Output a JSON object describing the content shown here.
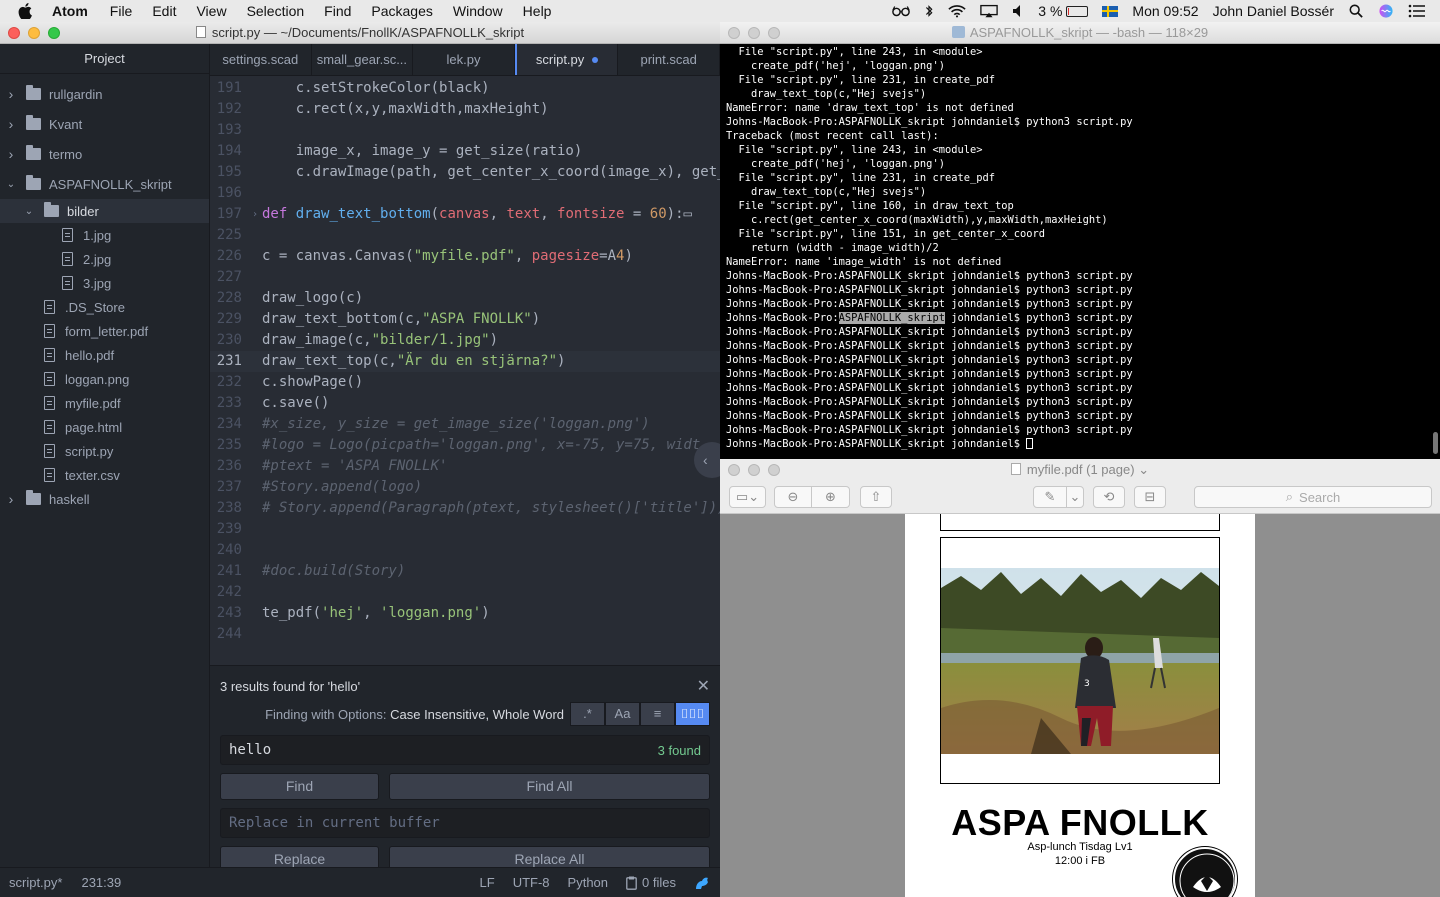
{
  "menubar": {
    "app": "Atom",
    "items": [
      "File",
      "Edit",
      "View",
      "Selection",
      "Find",
      "Packages",
      "Window",
      "Help"
    ],
    "battery": "3 %",
    "clock": "Mon 09:52",
    "user": "John Daniel Bossér"
  },
  "atom": {
    "title": "script.py — ~/Documents/FnollK/ASPAFNOLLK_skript",
    "tree_header": "Project",
    "tree": [
      {
        "label": "rullgardin",
        "kind": "folder",
        "expanded": false,
        "depth": 0
      },
      {
        "label": "Kvant",
        "kind": "folder",
        "expanded": false,
        "depth": 0
      },
      {
        "label": "termo",
        "kind": "folder",
        "expanded": false,
        "depth": 0
      },
      {
        "label": "ASPAFNOLLK_skript",
        "kind": "folder",
        "expanded": true,
        "depth": 0
      },
      {
        "label": "bilder",
        "kind": "folder",
        "expanded": true,
        "depth": 1,
        "selected": true
      },
      {
        "label": "1.jpg",
        "kind": "image",
        "depth": 2
      },
      {
        "label": "2.jpg",
        "kind": "image",
        "depth": 2
      },
      {
        "label": "3.jpg",
        "kind": "image",
        "depth": 2
      },
      {
        "label": ".DS_Store",
        "kind": "file",
        "depth": 1
      },
      {
        "label": "form_letter.pdf",
        "kind": "pdf",
        "depth": 1
      },
      {
        "label": "hello.pdf",
        "kind": "pdf",
        "depth": 1
      },
      {
        "label": "loggan.png",
        "kind": "image",
        "depth": 1
      },
      {
        "label": "myfile.pdf",
        "kind": "pdf",
        "depth": 1
      },
      {
        "label": "page.html",
        "kind": "file",
        "depth": 1
      },
      {
        "label": "script.py",
        "kind": "file",
        "depth": 1
      },
      {
        "label": "texter.csv",
        "kind": "file",
        "depth": 1
      },
      {
        "label": "haskell",
        "kind": "folder",
        "expanded": false,
        "depth": 0
      }
    ],
    "tabs": [
      {
        "label": "settings.scad",
        "active": false
      },
      {
        "label": "small_gear.sc...",
        "active": false
      },
      {
        "label": "lek.py",
        "active": false
      },
      {
        "label": "script.py",
        "active": true,
        "modified": true
      },
      {
        "label": "print.scad",
        "active": false
      }
    ],
    "code": [
      {
        "n": "191",
        "t": "    c.setStrokeColor(black)"
      },
      {
        "n": "192",
        "t": "    c.rect(x,y,maxWidth,maxHeight)"
      },
      {
        "n": "193",
        "t": ""
      },
      {
        "n": "194",
        "t": "    image_x, image_y = get_size(ratio)"
      },
      {
        "n": "195",
        "t": "    c.drawImage(path, get_center_x_coord(image_x), get_"
      },
      {
        "n": "196",
        "t": ""
      },
      {
        "n": "197",
        "t": "def draw_text_bottom(canvas, text, fontsize = 60):▭",
        "fold": true
      },
      {
        "n": "225",
        "t": ""
      },
      {
        "n": "226",
        "t": "c = canvas.Canvas(\"myfile.pdf\", pagesize=A4)"
      },
      {
        "n": "227",
        "t": ""
      },
      {
        "n": "228",
        "t": "draw_logo(c)"
      },
      {
        "n": "229",
        "t": "draw_text_bottom(c,\"ASPA FNOLLK\")"
      },
      {
        "n": "230",
        "t": "draw_image(c,\"bilder/1.jpg\")"
      },
      {
        "n": "231",
        "t": "draw_text_top(c,\"Är du en stjärna?\")",
        "current": true
      },
      {
        "n": "232",
        "t": "c.showPage()"
      },
      {
        "n": "233",
        "t": "c.save()"
      },
      {
        "n": "234",
        "t": "#x_size, y_size = get_image_size('loggan.png')"
      },
      {
        "n": "235",
        "t": "#logo = Logo(picpath='loggan.png', x=-75, y=75, widt"
      },
      {
        "n": "236",
        "t": "#ptext = 'ASPA FNOLLK'"
      },
      {
        "n": "237",
        "t": "#Story.append(logo)"
      },
      {
        "n": "238",
        "t": "# Story.append(Paragraph(ptext, stylesheet()['title']))"
      },
      {
        "n": "239",
        "t": ""
      },
      {
        "n": "240",
        "t": ""
      },
      {
        "n": "241",
        "t": "#doc.build(Story)"
      },
      {
        "n": "242",
        "t": ""
      },
      {
        "n": "243",
        "t": "te_pdf('hej', 'loggan.png')"
      },
      {
        "n": "244",
        "t": ""
      }
    ],
    "find": {
      "summary": "3 results found for 'hello'",
      "options_prefix": "Finding with Options:",
      "options": "Case Insensitive, Whole Word",
      "toggles": [
        ".*",
        "Aa",
        "≡",
        "⌷⌷⌷"
      ],
      "query": "hello",
      "count": "3 found",
      "find_label": "Find",
      "find_all_label": "Find All",
      "replace_placeholder": "Replace in current buffer",
      "replace_label": "Replace",
      "replace_all_label": "Replace All"
    },
    "status": {
      "file": "script.py*",
      "cursor": "231:39",
      "eol": "LF",
      "encoding": "UTF-8",
      "grammar": "Python",
      "files": "0 files"
    }
  },
  "terminal": {
    "title": "ASPAFNOLLK_skript — -bash — 118×29",
    "lines": [
      "  File \"script.py\", line 243, in <module>",
      "    create_pdf('hej', 'loggan.png')",
      "  File \"script.py\", line 231, in create_pdf",
      "    draw_text_top(c,\"Hej svejs\")",
      "NameError: name 'draw_text_top' is not defined",
      "Johns-MacBook-Pro:ASPAFNOLLK_skript johndaniel$ python3 script.py",
      "Traceback (most recent call last):",
      "  File \"script.py\", line 243, in <module>",
      "    create_pdf('hej', 'loggan.png')",
      "  File \"script.py\", line 231, in create_pdf",
      "    draw_text_top(c,\"Hej svejs\")",
      "  File \"script.py\", line 160, in draw_text_top",
      "    c.rect(get_center_x_coord(maxWidth),y,maxWidth,maxHeight)",
      "  File \"script.py\", line 151, in get_center_x_coord",
      "    return (width - image_width)/2",
      "NameError: name 'image_width' is not defined",
      "Johns-MacBook-Pro:ASPAFNOLLK_skript johndaniel$ python3 script.py",
      "Johns-MacBook-Pro:ASPAFNOLLK_skript johndaniel$ python3 script.py",
      "Johns-MacBook-Pro:ASPAFNOLLK_skript johndaniel$ python3 script.py",
      "Johns-MacBook-Pro:ASPAFNOLLK_skript johndaniel$ python3 script.py",
      "Johns-MacBook-Pro:ASPAFNOLLK_skript johndaniel$ python3 script.py",
      "Johns-MacBook-Pro:ASPAFNOLLK_skript johndaniel$ python3 script.py",
      "Johns-MacBook-Pro:ASPAFNOLLK_skript johndaniel$ python3 script.py",
      "Johns-MacBook-Pro:ASPAFNOLLK_skript johndaniel$ python3 script.py",
      "Johns-MacBook-Pro:ASPAFNOLLK_skript johndaniel$ python3 script.py",
      "Johns-MacBook-Pro:ASPAFNOLLK_skript johndaniel$ python3 script.py",
      "Johns-MacBook-Pro:ASPAFNOLLK_skript johndaniel$ python3 script.py",
      "Johns-MacBook-Pro:ASPAFNOLLK_skript johndaniel$ python3 script.py",
      "Johns-MacBook-Pro:ASPAFNOLLK_skript johndaniel$ "
    ],
    "selected_text": "ASPAFNOLLK_skript",
    "selected_line": 19
  },
  "preview": {
    "title": "myfile.pdf (1 page)",
    "search_placeholder": "Search",
    "page": {
      "heading": "ASPA FNOLLK",
      "line1": "Asp-lunch Tisdag Lv1",
      "line2": "12:00 i FB"
    }
  }
}
